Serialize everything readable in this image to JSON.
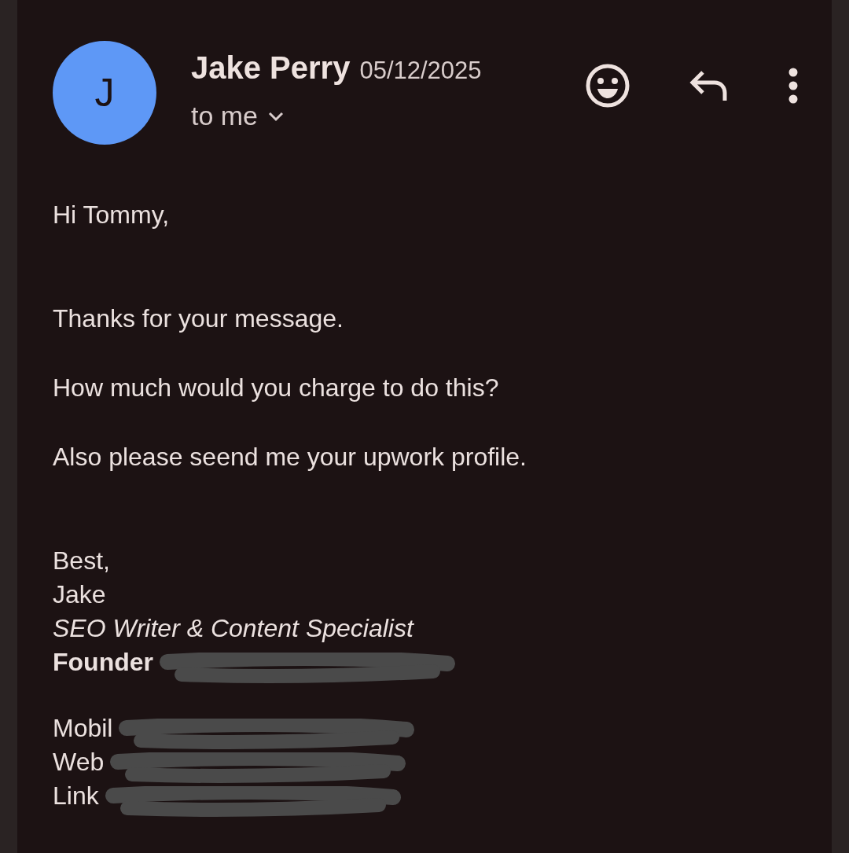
{
  "sender": {
    "initial": "J",
    "name": "Jake Perry",
    "date": "05/12/2025",
    "recipient": "to me"
  },
  "body": [
    "Hi Tommy,",
    "Thanks for your message.",
    "How much would you charge to do this?",
    "Also please seend me your upwork profile."
  ],
  "signature": [
    {
      "kind": "plain",
      "text": "Best,"
    },
    {
      "kind": "plain",
      "text": "Jake"
    },
    {
      "kind": "italic",
      "text": "SEO Writer & Content Specialist"
    },
    {
      "kind": "bold",
      "text": "Founder",
      "redacted": true
    },
    {
      "kind": "spacer"
    },
    {
      "kind": "plain",
      "text": "Mobil",
      "redacted": true
    },
    {
      "kind": "plain",
      "text": "Web",
      "redacted": true
    },
    {
      "kind": "plain",
      "text": "Link",
      "redacted": true
    }
  ]
}
